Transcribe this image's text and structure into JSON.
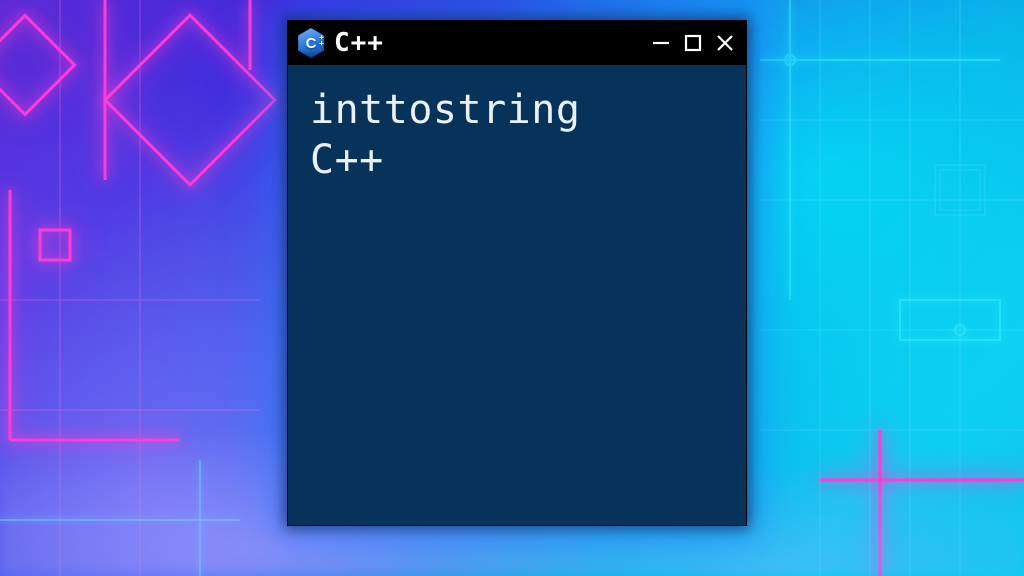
{
  "window": {
    "title": "C++",
    "icon": "cpp-icon",
    "controls": {
      "minimize": "minimize-icon",
      "maximize": "maximize-icon",
      "close": "close-icon"
    }
  },
  "content": {
    "line1": "inttostring",
    "line2": "C++"
  },
  "colors": {
    "window_bg": "#07335a",
    "titlebar_bg": "#000000",
    "text": "#e9f1f6",
    "neon_pink": "#ff3bd6",
    "neon_cyan": "#3bf0ff"
  }
}
